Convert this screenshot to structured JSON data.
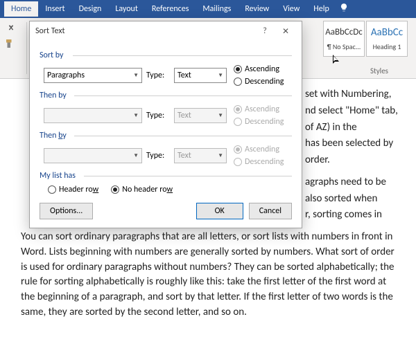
{
  "ribbon": {
    "tabs": [
      "Home",
      "Insert",
      "Design",
      "Layout",
      "References",
      "Mailings",
      "Review",
      "View",
      "Help"
    ],
    "active": "Home"
  },
  "styles": {
    "box1_sample": "AaBbCcDc",
    "box1_label": "¶ No Spac...",
    "box2_sample": "AaBbCc",
    "box2_label": "Heading 1",
    "group_label": "Styles"
  },
  "dialog": {
    "title": "Sort Text",
    "sortby_label": "Sort by",
    "thenby_label": "Then by",
    "mylist_label": "My list has",
    "type_label": "Type:",
    "field1": "Paragraphs",
    "type1": "Text",
    "type2": "Text",
    "type3": "Text",
    "asc": "Ascending",
    "desc": "Descending",
    "header": "Header row",
    "noheader": "No header row",
    "options": "Options...",
    "ok": "OK",
    "cancel": "Cancel"
  },
  "doc": {
    "p1_a": "set with Numbering,",
    "p1_b": "nd  select \"Home\" tab,",
    "p1_c": "of AZ) in the",
    "p1_d": "has been selected by",
    "p1_e": "order.",
    "p1_f": "agraphs need to be",
    "p1_g": "also sorted when",
    "p1_h": "r, sorting comes in",
    "p2": "You can sort ordinary paragraphs that are all letters, or sort lists with numbers in front in Word. Lists beginning with numbers are generally sorted by numbers. What sort of order is used for ordinary paragraphs without numbers? They can be sorted alphabetically; the rule for sorting alphabetically is roughly like this: take the first letter of the first word at the beginning of a paragraph, and sort by that letter. If the first letter of two words is the same, they are sorted by the second letter, and so on."
  }
}
